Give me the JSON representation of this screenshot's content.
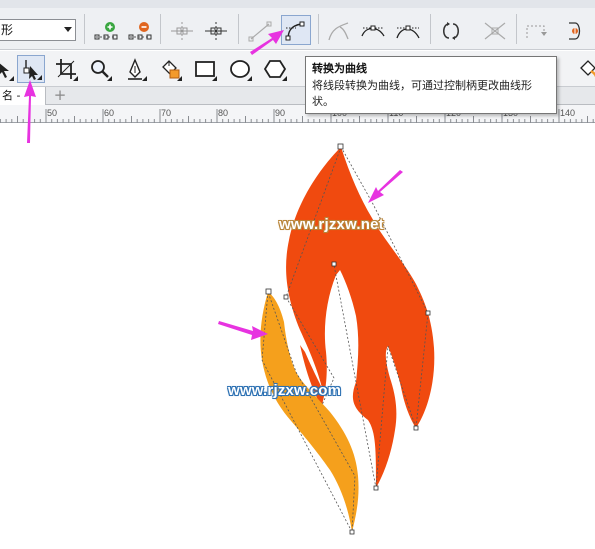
{
  "property_bar": {
    "shape_combo_value": "形"
  },
  "document": {
    "tab_label": "名 -",
    "add_tab_symbol": "+"
  },
  "ruler": {
    "ticks": [
      "50",
      "60",
      "70",
      "80",
      "90",
      "100",
      "110",
      "120",
      "130",
      "140"
    ]
  },
  "tooltip": {
    "title": "转换为曲线",
    "body": "将线段转换为曲线，可通过控制柄更改曲线形状。"
  },
  "watermarks": {
    "top": "www.rjzxw.net",
    "bottom": "www.rjzxw.com"
  },
  "colors": {
    "flame_red": "#f04a0f",
    "flame_orange": "#f5a01c",
    "annotation_arrow": "#e733e0",
    "toolbar_bg": "#eef0f3"
  },
  "icons": {
    "add_node": "add-node-icon",
    "delete_node": "delete-node-icon",
    "join_nodes": "join-nodes-icon",
    "break_curve": "break-curve-icon",
    "to_line": "convert-to-line-icon",
    "to_curve": "convert-to-curve-icon",
    "cusp": "cusp-node-icon",
    "smooth": "smooth-node-icon",
    "symmetrical": "symmetrical-node-icon",
    "reverse": "reverse-direction-icon",
    "extract": "extract-subpath-icon",
    "extend": "extend-curve-icon",
    "shape_tool": "shape-tool-icon",
    "crop": "crop-tool-icon",
    "zoom": "zoom-tool-icon",
    "freehand": "pen-tool-icon",
    "fill": "smart-fill-icon",
    "rectangle": "rectangle-tool-icon",
    "ellipse": "ellipse-tool-icon",
    "polygon": "polygon-tool-icon"
  }
}
